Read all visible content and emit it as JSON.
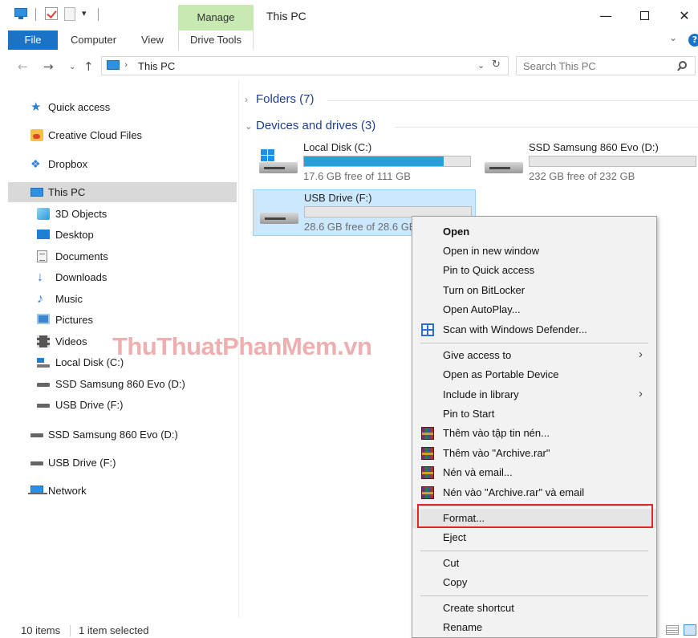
{
  "titlebar": {
    "title": "This PC",
    "context_tab": "Manage",
    "minimize_glyph": "—",
    "close_glyph": "✕",
    "quick_access_dropdown_glyph": "▾"
  },
  "ribbon": {
    "tabs": [
      "File",
      "Computer",
      "View",
      "Drive Tools"
    ],
    "expand_glyph": "⌄",
    "help_glyph": "?"
  },
  "address": {
    "back_glyph": "←",
    "forward_glyph": "→",
    "recent_glyph": "⌄",
    "up_glyph": "↑",
    "separator_glyph": "›",
    "path": "This PC",
    "dropdown_glyph": "⌄",
    "refresh_glyph": "↻",
    "search_placeholder": "Search This PC"
  },
  "nav": {
    "items": [
      {
        "label": "Quick access",
        "icon": "star-icon"
      },
      {
        "label": "Creative Cloud Files",
        "icon": "creative-cloud-icon"
      },
      {
        "label": "Dropbox",
        "icon": "dropbox-icon"
      },
      {
        "label": "This PC",
        "icon": "computer-icon",
        "selected": true
      },
      {
        "label": "3D Objects",
        "icon": "cube-icon"
      },
      {
        "label": "Desktop",
        "icon": "desktop-icon"
      },
      {
        "label": "Documents",
        "icon": "document-icon"
      },
      {
        "label": "Downloads",
        "icon": "download-arrow-icon"
      },
      {
        "label": "Music",
        "icon": "music-note-icon"
      },
      {
        "label": "Pictures",
        "icon": "picture-icon"
      },
      {
        "label": "Videos",
        "icon": "film-icon"
      },
      {
        "label": "Local Disk (C:)",
        "icon": "windows-drive-icon"
      },
      {
        "label": "SSD Samsung 860 Evo (D:)",
        "icon": "drive-icon"
      },
      {
        "label": "USB Drive (F:)",
        "icon": "drive-icon"
      },
      {
        "label": "SSD Samsung 860 Evo (D:)",
        "icon": "drive-icon"
      },
      {
        "label": "USB Drive (F:)",
        "icon": "drive-icon"
      },
      {
        "label": "Network",
        "icon": "network-icon"
      }
    ]
  },
  "content": {
    "folders_group": "Folders (7)",
    "devices_group": "Devices and drives (3)",
    "collapsed_chevron": "›",
    "expanded_chevron": "⌄",
    "drives": [
      {
        "name": "Local Disk (C:)",
        "free": "17.6 GB free of 111 GB",
        "used_fraction": 0.84
      },
      {
        "name": "SSD Samsung 860 Evo (D:)",
        "free": "232 GB free of 232 GB",
        "used_fraction": 0.0
      },
      {
        "name": "USB Drive (F:)",
        "free": "28.6 GB free of 28.6 GB",
        "used_fraction": 0.0
      }
    ]
  },
  "watermark": "ThuThuatPhanMem.vn",
  "status": {
    "items": "10 items",
    "selected": "1 item selected"
  },
  "context_menu": {
    "submenu_glyph": "›",
    "items": [
      "Open",
      "Open in new window",
      "Pin to Quick access",
      "Turn on BitLocker",
      "Open AutoPlay...",
      "Scan with Windows Defender...",
      "Give access to",
      "Open as Portable Device",
      "Include in library",
      "Pin to Start",
      "Thêm vào tập tin nén...",
      "Thêm vào \"Archive.rar\"",
      "Nén và email...",
      "Nén vào \"Archive.rar\" và email",
      "Format...",
      "Eject",
      "Cut",
      "Copy",
      "Create shortcut",
      "Rename"
    ]
  },
  "colors": {
    "accent": "#1a73c7",
    "manage_tab": "#c6eab1",
    "selection": "#cce8ff",
    "drive_fill": "#26a0da",
    "highlight_border": "#e0262a",
    "group_heading": "#1e3f8f"
  }
}
